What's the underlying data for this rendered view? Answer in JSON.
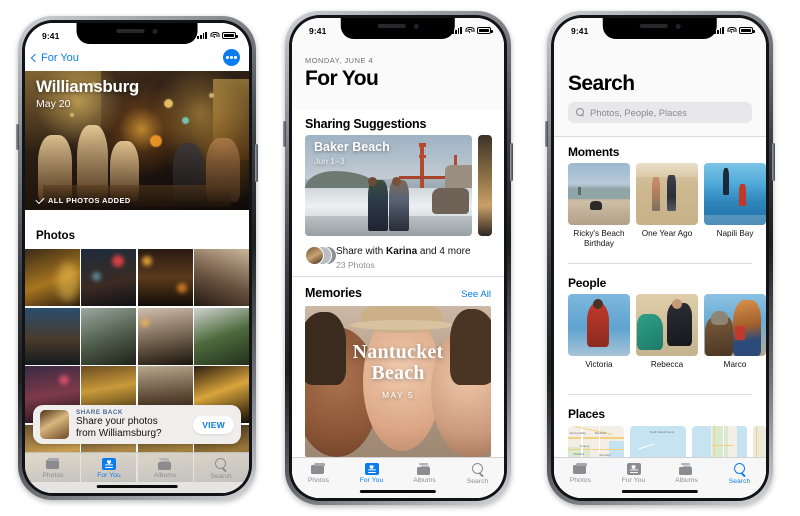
{
  "statusbar": {
    "time": "9:41",
    "signal_icon": "cellular-bars-icon",
    "wifi_icon": "wifi-icon",
    "battery_icon": "battery-icon"
  },
  "phone1": {
    "nav": {
      "back_label": "For You",
      "back_icon": "chevron-left-icon",
      "more_icon": "more-dots-icon"
    },
    "hero": {
      "title": "Williamsburg",
      "date": "May 20",
      "status": "ALL PHOTOS ADDED",
      "check_icon": "checkmark-icon"
    },
    "section_header": "Photos",
    "share_back": {
      "kicker": "SHARE BACK",
      "line1": "Share your photos",
      "line2": "from Williamsburg?",
      "button": "VIEW"
    },
    "tabs": [
      {
        "label": "Photos",
        "icon": "photos-icon",
        "active": false
      },
      {
        "label": "For You",
        "icon": "for-you-icon",
        "active": true
      },
      {
        "label": "Albums",
        "icon": "albums-icon",
        "active": false
      },
      {
        "label": "Search",
        "icon": "search-icon",
        "active": false
      }
    ]
  },
  "phone2": {
    "date": "MONDAY, JUNE 4",
    "title": "For You",
    "sharing_suggestions": {
      "header": "Sharing Suggestions",
      "card": {
        "title": "Baker Beach",
        "date": "Jun 1–3"
      },
      "share_line": "Share with ",
      "share_name": "Karina",
      "share_line_end": " and 4 more",
      "photo_count": "23 Photos"
    },
    "memories": {
      "header": "Memories",
      "see_all": "See All",
      "card_title_line1": "Nantucket",
      "card_title_line2": "Beach",
      "card_date": "MAY 5"
    },
    "tabs": [
      {
        "label": "Photos",
        "icon": "photos-icon",
        "active": false
      },
      {
        "label": "For You",
        "icon": "for-you-icon",
        "active": true
      },
      {
        "label": "Albums",
        "icon": "albums-icon",
        "active": false
      },
      {
        "label": "Search",
        "icon": "search-icon",
        "active": false
      }
    ]
  },
  "phone3": {
    "title": "Search",
    "search_placeholder": "Photos, People, Places",
    "search_icon": "search-icon",
    "moments": {
      "header": "Moments",
      "items": [
        {
          "caption": "Ricky's Beach Birthday"
        },
        {
          "caption": "One Year Ago"
        },
        {
          "caption": "Napili Bay"
        }
      ]
    },
    "people": {
      "header": "People",
      "items": [
        {
          "caption": "Victoria"
        },
        {
          "caption": "Rebecca"
        },
        {
          "caption": "Marco"
        }
      ]
    },
    "places": {
      "header": "Places",
      "map_labels": [
        "Spring Valley",
        "Stamford",
        "Yonkers",
        "Portland",
        "New Roc",
        "Smith Island Sound"
      ]
    },
    "tabs": [
      {
        "label": "Photos",
        "icon": "photos-icon",
        "active": false
      },
      {
        "label": "For You",
        "icon": "for-you-icon",
        "active": false
      },
      {
        "label": "Albums",
        "icon": "albums-icon",
        "active": false
      },
      {
        "label": "Search",
        "icon": "search-icon",
        "active": true
      }
    ]
  },
  "colors": {
    "accent": "#0a7cf0",
    "tab_inactive": "#8c8c90",
    "bg": "#ffffff"
  }
}
